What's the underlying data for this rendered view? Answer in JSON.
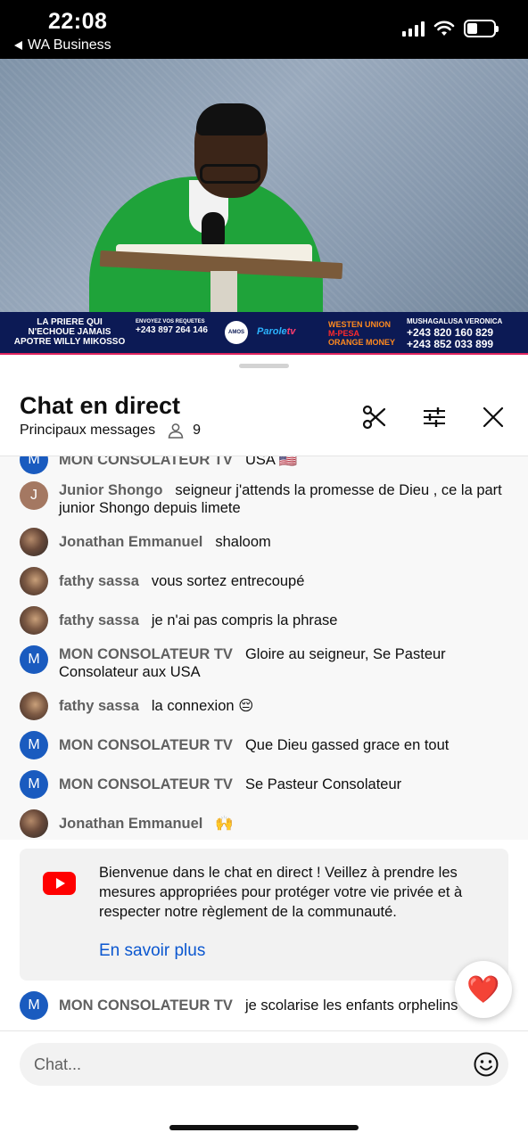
{
  "status_bar": {
    "time": "22:08",
    "back_label": "WA Business"
  },
  "video": {
    "banner": {
      "left_line1": "LA PRIERE QUI",
      "left_line2": "N'ECHOUE JAMAIS",
      "left_line3": "APOTRE WILLY MIKOSSO",
      "requests_label": "ENVOYEZ VOS REQUETES",
      "requests_number": "+243 897 264 146",
      "logo1": "AMOS",
      "logo2_a": "Parole",
      "logo2_b": "tv",
      "west_union": "WESTEN UNION",
      "mpesa": "M-PESA",
      "orange_money": "ORANGE MONEY",
      "recipient": "MUSHAGALUSA VERONICA",
      "number1": "+243 820 160 829",
      "number2": "+243 852 033 899"
    }
  },
  "chat": {
    "title": "Chat en direct",
    "subtitle": "Principaux messages",
    "viewers": "9",
    "messages": [
      {
        "author": "MON CONSOLATEUR TV",
        "text": "USA 🇺🇸",
        "avatar": "M"
      },
      {
        "author": "Junior Shongo",
        "text": "seigneur j'attends la promesse de Dieu , ce la part junior Shongo depuis limete",
        "avatar": "J"
      },
      {
        "author": "Jonathan Emmanuel",
        "text": "shaloom",
        "avatar": ""
      },
      {
        "author": "fathy sassa",
        "text": "vous sortez entrecoupé",
        "avatar": ""
      },
      {
        "author": "fathy sassa",
        "text": "je n'ai pas compris la phrase",
        "avatar": ""
      },
      {
        "author": "MON CONSOLATEUR TV",
        "text": "Gloire au seigneur, Se Pasteur Consolateur aux USA",
        "avatar": "M"
      },
      {
        "author": "fathy sassa",
        "text": "la connexion 😔",
        "avatar": ""
      },
      {
        "author": "MON CONSOLATEUR TV",
        "text": "Que Dieu gassed grace en tout",
        "avatar": "M"
      },
      {
        "author": "MON CONSOLATEUR TV",
        "text": "Se Pasteur Consolateur",
        "avatar": "M"
      },
      {
        "author": "Jonathan Emmanuel",
        "text": "🙌",
        "avatar": ""
      }
    ],
    "notice": {
      "text": "Bienvenue dans le chat en direct ! Veillez à prendre les mesures appropriées pour protéger votre vie privée et à respecter notre règlement de la communauté.",
      "link": "En savoir plus"
    },
    "last_message": {
      "author": "MON CONSOLATEUR TV",
      "text": "je scolarise les enfants orphelins",
      "avatar": "M"
    },
    "heart": "❤️",
    "input_placeholder": "Chat..."
  }
}
